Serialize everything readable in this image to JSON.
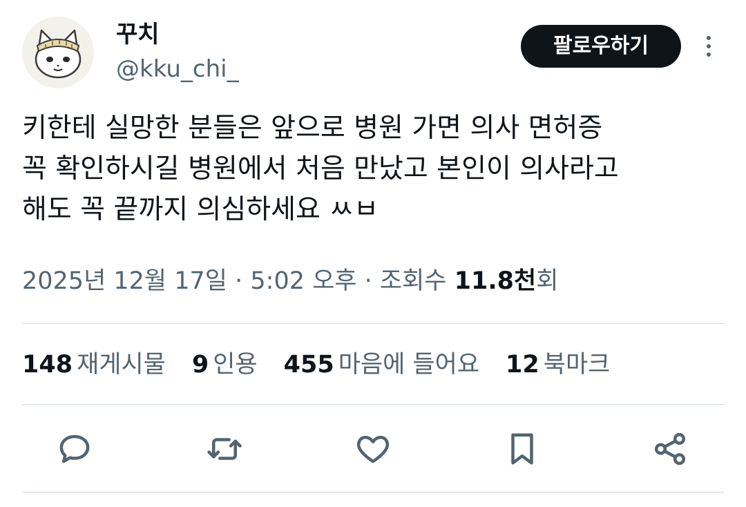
{
  "author": {
    "display_name": "꾸치",
    "handle": "@kku_chi_",
    "avatar_icon": "cat-avatar-icon"
  },
  "header": {
    "follow_label": "팔로우하기",
    "more_icon": "more-vertical-icon"
  },
  "tweet": {
    "lines": [
      "키한테 실망한 분들은 앞으로 병원 가면 의사 면허증",
      "꼭 확인하시길 병원에서 처음 만났고 본인이 의사라고",
      "해도 꼭 끝까지 의심하세요 ㅆㅂ"
    ]
  },
  "meta": {
    "date": "2025년 12월 17일",
    "separator": " · ",
    "time": "5:02 오후",
    "views_label": "조회수",
    "views_count": "11.8천",
    "views_suffix": "회"
  },
  "stats": [
    {
      "count": "148",
      "label": "재게시물"
    },
    {
      "count": "9",
      "label": "인용"
    },
    {
      "count": "455",
      "label": "마음에 들어요"
    },
    {
      "count": "12",
      "label": "북마크"
    }
  ],
  "actions": [
    "reply-icon",
    "repost-icon",
    "like-icon",
    "bookmark-icon",
    "share-icon"
  ],
  "colors": {
    "text_primary": "#0f1419",
    "text_secondary": "#536471",
    "divider": "#cfd9de",
    "button_bg": "#0f1419"
  }
}
